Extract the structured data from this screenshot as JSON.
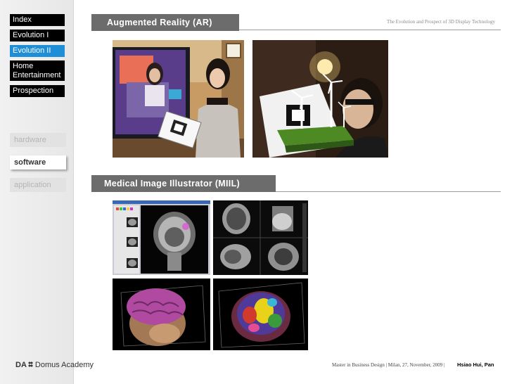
{
  "header": {
    "title": "The Evolution and Prospect of 3D Display Technology"
  },
  "sidebar": {
    "nav": [
      {
        "label": "Index"
      },
      {
        "label": "Evolution I"
      },
      {
        "label": "Evolution II",
        "active": true
      },
      {
        "label": "Home Entertainment"
      },
      {
        "label": "Prospection"
      }
    ],
    "subnav": [
      {
        "label": "hardware"
      },
      {
        "label": "software",
        "active": true
      },
      {
        "label": "application"
      }
    ]
  },
  "sections": [
    {
      "title": "Augmented Reality (AR)"
    },
    {
      "title": "Medical Image Illustrator (MIIL)"
    }
  ],
  "footer": {
    "logo_mark": "DA",
    "logo_name": "Domus Academy",
    "info": "Master in Business Design |  Milan, 27,  November, 2009  |",
    "author": "Hsiao Hui, Pan"
  },
  "colors": {
    "active_nav": "#1e8fd6",
    "nav_bg": "#000000",
    "section_tab": "#6c6c6c"
  }
}
